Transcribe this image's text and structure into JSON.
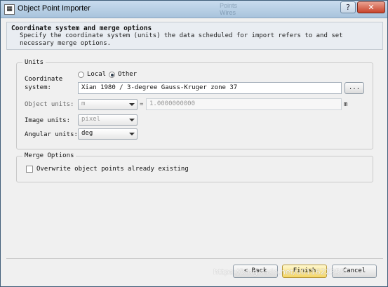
{
  "window": {
    "title": "Object Point Importer",
    "help_glyph": "?",
    "close_glyph": "✕",
    "app_icon_glyph": "▦"
  },
  "background_ghost": [
    "Points",
    "Wires",
    "Units"
  ],
  "header": {
    "title": "Coordinate system and merge options",
    "description": "Specify the coordinate system (units) the data scheduled for import refers to and set necessary merge options."
  },
  "units_group": {
    "legend": "Units",
    "coordinate_system_label_1": "Coordinate",
    "coordinate_system_label_2": "system:",
    "radio_local": "Local",
    "radio_other": "Other",
    "selected_radio": "Other",
    "coordinate_system_value": "Xian 1980 / 3-degree Gauss-Kruger zone 37",
    "browse_label": "...",
    "object_units_label": "Object units:",
    "object_units_value": "m",
    "equals": "=",
    "factor_value": "1.0000000000",
    "factor_unit": "m",
    "image_units_label": "Image units:",
    "image_units_value": "pixel",
    "angular_units_label": "Angular units:",
    "angular_units_value": "deg"
  },
  "merge_group": {
    "legend": "Merge Options",
    "overwrite_label": "Overwrite object points already existing",
    "overwrite_checked": false
  },
  "buttons": {
    "back": "< Back",
    "finish": "Finish",
    "cancel": "Cancel"
  },
  "watermark": "https://blog.csdn.net/u011622358",
  "colors": {
    "title_bar": "#b7cde3",
    "close_button": "#c8432b",
    "default_button": "#f5d667"
  }
}
